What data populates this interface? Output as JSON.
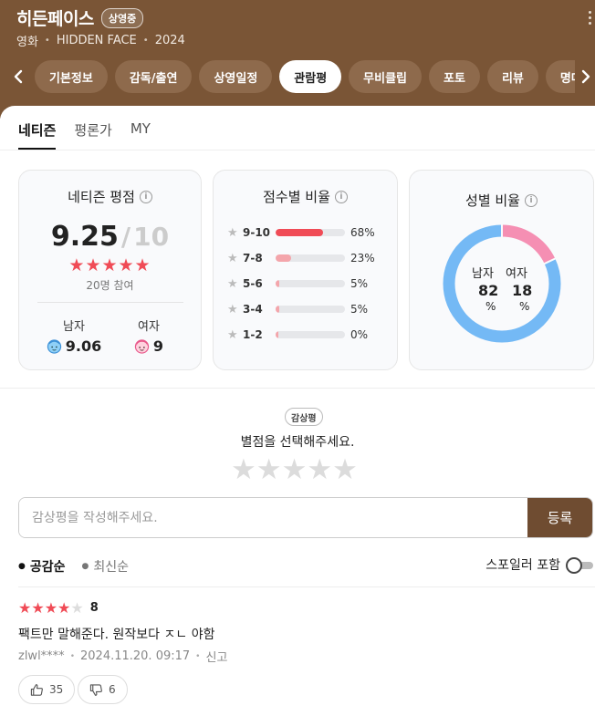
{
  "header": {
    "title": "히든페이스",
    "badge": "상영중",
    "genre": "영화",
    "english_title": "HIDDEN FACE",
    "year": "2024"
  },
  "tabs": [
    {
      "label": "기본정보",
      "active": false
    },
    {
      "label": "감독/출연",
      "active": false
    },
    {
      "label": "상영일정",
      "active": false
    },
    {
      "label": "관람평",
      "active": true
    },
    {
      "label": "무비클립",
      "active": false
    },
    {
      "label": "포토",
      "active": false
    },
    {
      "label": "리뷰",
      "active": false
    },
    {
      "label": "명대사",
      "active": false
    }
  ],
  "subtabs": [
    {
      "label": "네티즌",
      "active": true
    },
    {
      "label": "평론가",
      "active": false
    },
    {
      "label": "MY",
      "active": false
    }
  ],
  "netizen_score": {
    "title": "네티즌 평점",
    "score": "9.25",
    "separator": "/",
    "max": "10",
    "stars": "★★★★★",
    "participants": "20명 참여",
    "male_label": "남자",
    "male_score": "9.06",
    "female_label": "여자",
    "female_score": "9"
  },
  "distribution": {
    "title": "점수별 비율",
    "rows": [
      {
        "range": "9-10",
        "percent": "68%",
        "value": 68,
        "color": "#f04b56"
      },
      {
        "range": "7-8",
        "percent": "23%",
        "value": 23,
        "color": "#f4a5ab"
      },
      {
        "range": "5-6",
        "percent": "5%",
        "value": 5,
        "color": "#f4a5ab"
      },
      {
        "range": "3-4",
        "percent": "5%",
        "value": 5,
        "color": "#f4a5ab"
      },
      {
        "range": "1-2",
        "percent": "0%",
        "value": 0,
        "color": "#f4a5ab"
      }
    ]
  },
  "gender_ratio": {
    "title": "성별 비율",
    "male_label": "남자",
    "female_label": "여자",
    "male_value": "82",
    "female_value": "18",
    "unit": "%",
    "male_color": "#74b9f5",
    "female_color": "#f58fb3"
  },
  "review_input": {
    "badge": "감상평",
    "prompt": "별점을 선택해주세요.",
    "stars": "★★★★★",
    "placeholder": "감상평을 작성해주세요.",
    "submit_label": "등록"
  },
  "sort": {
    "options": [
      "공감순",
      "최신순"
    ],
    "spoiler_label": "스포일러 포함"
  },
  "reviews": [
    {
      "stars_on": "★★★★",
      "stars_off": "★",
      "score": "8",
      "text": "팩트만 말해준다. 원작보다 ㅈㄴ 야함",
      "author": "zlwl****",
      "date": "2024.11.20. 09:17",
      "report": "신고",
      "likes": "35",
      "dislikes": "6"
    }
  ],
  "colors": {
    "header_bg": "#7a5536",
    "accent_red": "#f04b56",
    "submit_bg": "#6f4c31"
  }
}
